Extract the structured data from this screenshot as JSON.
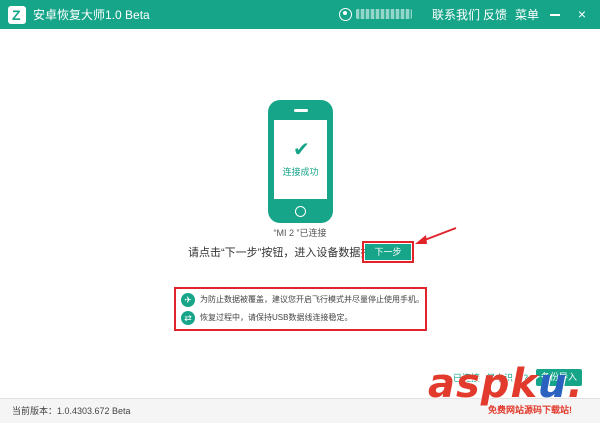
{
  "titlebar": {
    "app_title": "安卓恢复大师1.0 Beta",
    "contact_label": "联系我们",
    "feedback_label": "反馈",
    "menu_label": "菜单",
    "close_glyph": "×"
  },
  "phone": {
    "status_text": "连接成功",
    "device_label": "“MI 2 ”已连接"
  },
  "instruction_text": "请点击“下一步”按钮，进入设备数据扫描",
  "next_button_label": "下一步",
  "notes": [
    {
      "icon": "airplane-icon",
      "text": "为防止数据被覆盖，建议您开启飞行模式并尽量停止使用手机。"
    },
    {
      "icon": "usb-icon",
      "text": "恢复过程中，请保持USB数据线连接稳定。"
    }
  ],
  "bottom": {
    "connected_link": "已连接",
    "help_link": "但未识",
    "q_mark": "?",
    "export_button": "备份导入"
  },
  "footer": {
    "version_text": "当前版本：1.0.4303.672 Beta"
  },
  "watermark": {
    "main_a": "asp",
    "main_k": "k",
    "main_u": "u",
    "main_dot": ".",
    "sub": "免费网站源码下载站!"
  },
  "colors": {
    "accent": "#17a589",
    "highlight_border": "#e0242a"
  }
}
